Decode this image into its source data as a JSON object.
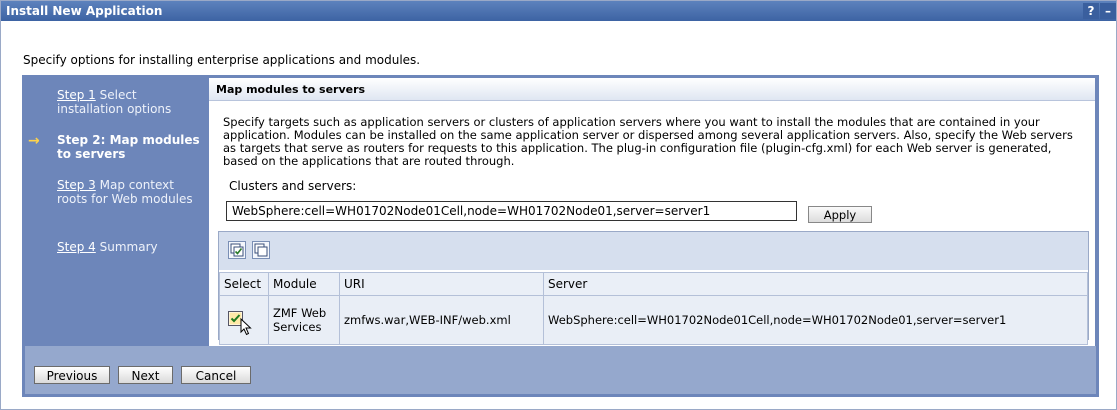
{
  "window": {
    "title": "Install New Application",
    "help_label": "?",
    "minimize_label": "–"
  },
  "intro": "Specify options for installing enterprise applications and modules.",
  "steps": [
    {
      "link": "Step 1",
      "text": "Select installation options"
    },
    {
      "label": "Step 2: Map modules to servers"
    },
    {
      "link": "Step 3",
      "text": "Map context roots for Web modules"
    },
    {
      "link": "Step 4",
      "text": "Summary"
    }
  ],
  "content": {
    "title": "Map modules to servers",
    "description": "Specify targets such as application servers or clusters of application servers where you want to install the modules that are contained in your application. Modules can be installed on the same application server or dispersed among several application servers. Also, specify the Web servers as targets that serve as routers for requests to this application. The plug-in configuration file (plugin-cfg.xml) for each Web server is generated, based on the applications that are routed through.",
    "clusters_label": "Clusters and servers:",
    "clusters_value": "WebSphere:cell=WH01702Node01Cell,node=WH01702Node01,server=server1",
    "apply_label": "Apply"
  },
  "table": {
    "headers": [
      "Select",
      "Module",
      "URI",
      "Server"
    ],
    "rows": [
      {
        "selected": true,
        "module": "ZMF Web Services",
        "uri": "zmfws.war,WEB-INF/web.xml",
        "server": "WebSphere:cell=WH01702Node01Cell,node=WH01702Node01,server=server1"
      }
    ]
  },
  "buttons": {
    "previous": "Previous",
    "next": "Next",
    "cancel": "Cancel"
  },
  "icons": {
    "select_all": "select-all-icon",
    "deselect_all": "deselect-all-icon",
    "current_step": "arrow-right-icon"
  },
  "colors": {
    "titlebar": "#3d63a3",
    "wizard_bg": "#6d86ba",
    "current_arrow": "#ffd34a"
  }
}
